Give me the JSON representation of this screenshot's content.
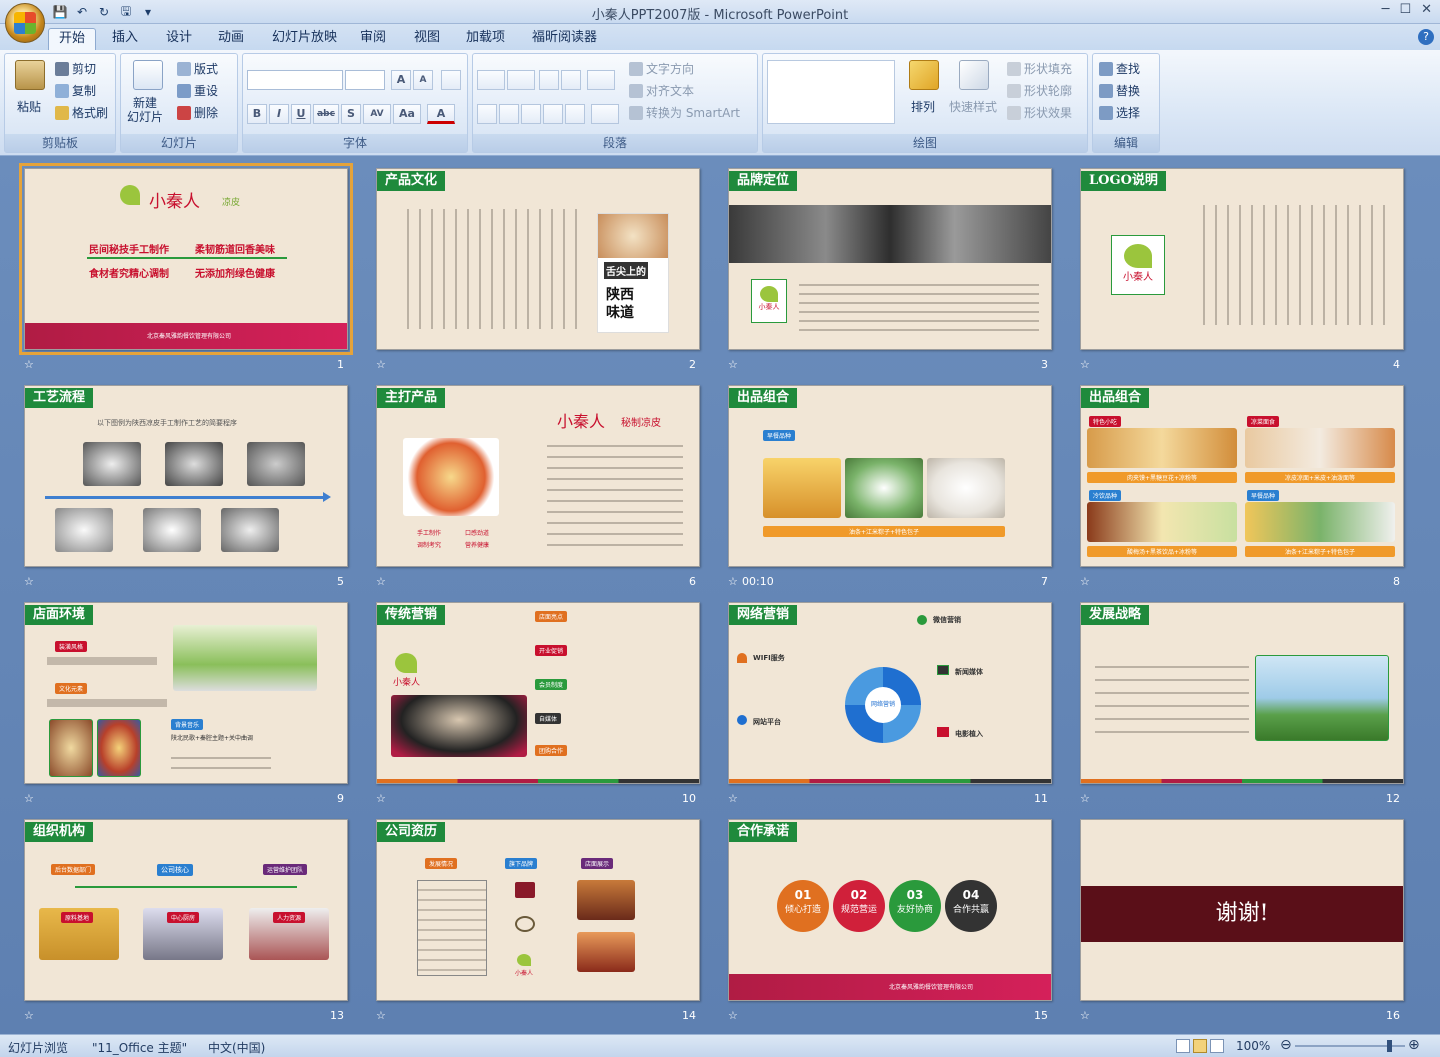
{
  "window": {
    "title": "小秦人PPT2007版 - Microsoft PowerPoint",
    "min": "─",
    "max": "☐",
    "close": "✕"
  },
  "qat": [
    "💾",
    "↶",
    "↻",
    "🖫",
    "▾"
  ],
  "tabs": [
    "开始",
    "插入",
    "设计",
    "动画",
    "幻灯片放映",
    "审阅",
    "视图",
    "加载项",
    "福昕阅读器"
  ],
  "active_tab": "开始",
  "help": "?",
  "ribbon": {
    "clipboard": {
      "label": "剪贴板",
      "paste": "粘贴",
      "cut": "剪切",
      "copy": "复制",
      "format_painter": "格式刷"
    },
    "slides": {
      "label": "幻灯片",
      "new_slide": "新建\n幻灯片",
      "layout": "版式",
      "reset": "重设",
      "delete": "删除"
    },
    "font": {
      "label": "字体",
      "bold": "B",
      "italic": "I",
      "underline": "U",
      "strike": "abc",
      "shadow": "S",
      "spacing": "AV",
      "case": "Aa",
      "color": "A",
      "grow": "A",
      "shrink": "A"
    },
    "paragraph": {
      "label": "段落",
      "text_direction": "文字方向",
      "align_text": "对齐文本",
      "smartart": "转换为 SmartArt"
    },
    "drawing": {
      "label": "绘图",
      "arrange": "排列",
      "quick_styles": "快速样式",
      "fill": "形状填充",
      "outline": "形状轮廓",
      "effects": "形状效果"
    },
    "editing": {
      "label": "编辑",
      "find": "查找",
      "replace": "替换",
      "select": "选择"
    }
  },
  "slides": [
    {
      "num": "1",
      "title": "",
      "brand": "小秦人",
      "brand_sub": "凉皮",
      "line1a": "民间秘技手工制作",
      "line1b": "柔韧筋道回香美味",
      "line2a": "食材者究精心调制",
      "line2b": "无添加剂绿色健康",
      "footer": "北京秦风雅韵餐饮管理有限公司"
    },
    {
      "num": "2",
      "title": "产品文化",
      "poster_top": "舌尖上的",
      "poster_bottom": "陕西味道"
    },
    {
      "num": "3",
      "title": "品牌定位",
      "brand": "小秦人"
    },
    {
      "num": "4",
      "title": "LOGO说明",
      "brand": "小秦人"
    },
    {
      "num": "5",
      "title": "工艺流程",
      "sub": "以下图例为陕西凉皮手工制作工艺的简要程序"
    },
    {
      "num": "6",
      "title": "主打产品",
      "brand": "小秦人",
      "brand_sub": "秘制凉皮",
      "feat1": "手工制作",
      "feat2": "口感劲道",
      "feat3": "调制考究",
      "feat4": "营养健康"
    },
    {
      "num": "7",
      "title": "出品组合",
      "time": "00:10",
      "tag": "早餐品种",
      "caption": "油条+江米粽子+特色包子"
    },
    {
      "num": "8",
      "title": "出品组合",
      "tag1": "特色小吃",
      "tag2": "凉菜面食",
      "tag3": "冷饮品种",
      "tag4": "早餐品种",
      "cap1": "肉夹馍+黑糖豆花+凉粉等",
      "cap2": "凉皮凉面+米皮+油泼面等",
      "cap3": "酸梅汤+黑茶饮品+冰粉等",
      "cap4": "油条+江米粽子+特色包子"
    },
    {
      "num": "9",
      "title": "店面环境",
      "tag1": "装潢风格",
      "tag2": "文化元素",
      "tag3": "背景音乐",
      "music": "陕北民歌+秦腔主题+关中曲调"
    },
    {
      "num": "10",
      "title": "传统营销",
      "brand": "小秦人",
      "i1": "店面亮点",
      "i2": "开业促销",
      "i3": "会员制度",
      "i4": "自媒体",
      "i5": "团购合作"
    },
    {
      "num": "11",
      "title": "网络营销",
      "w1": "WIFI服务",
      "w2": "网站平台",
      "w3": "微信营销",
      "w4": "新闻媒体",
      "w5": "电影植入",
      "center": "网络营销"
    },
    {
      "num": "12",
      "title": "发展战略"
    },
    {
      "num": "13",
      "title": "组织机构",
      "core": "公司核心",
      "left": "后台数据部门",
      "right": "运营维护团队",
      "b1": "原料基地",
      "b2": "中心厨房",
      "b3": "人力资源"
    },
    {
      "num": "14",
      "title": "公司资历",
      "t1": "发展情况",
      "t2": "旗下品牌",
      "t3": "店面展示",
      "brand": "小秦人"
    },
    {
      "num": "15",
      "title": "合作承诺",
      "c1n": "01",
      "c1": "倾心打造",
      "c2n": "02",
      "c2": "规范营运",
      "c3n": "03",
      "c3": "友好协商",
      "c4n": "04",
      "c4": "合作共赢",
      "footer": "北京秦风雅韵餐饮管理有限公司"
    },
    {
      "num": "16",
      "title": "",
      "thanks": "谢谢!"
    }
  ],
  "status": {
    "view": "幻灯片浏览",
    "theme": "\"11_Office 主题\"",
    "lang": "中文(中国)",
    "zoom": "100%"
  },
  "colors": {
    "accent_green": "#1f8a3c",
    "accent_red": "#b01c44",
    "accent_orange": "#e07020",
    "bg_slide": "#f1e6d6"
  }
}
